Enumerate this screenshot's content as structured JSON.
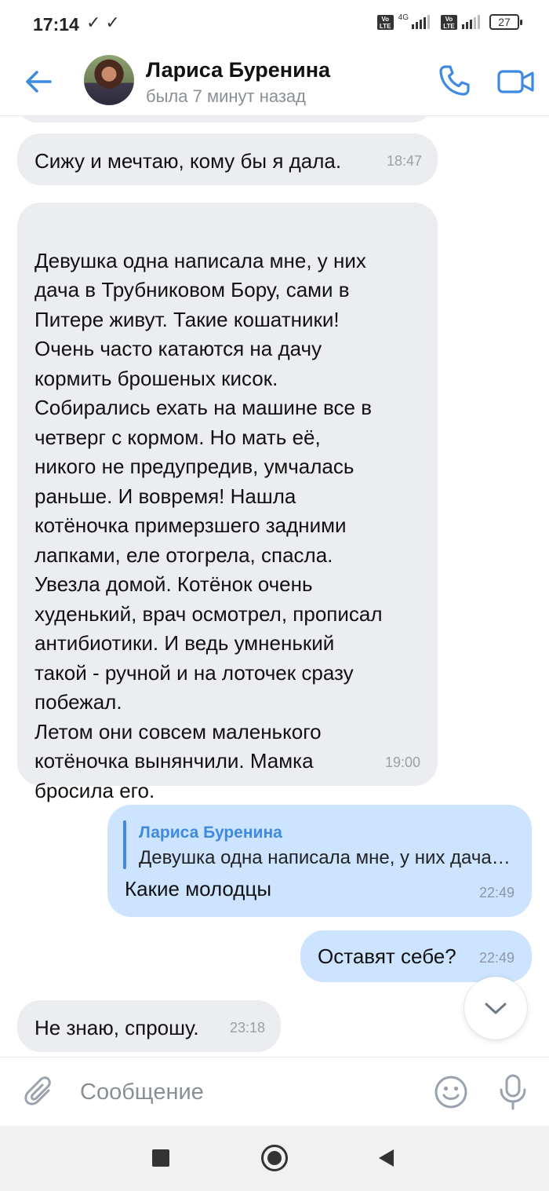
{
  "status_bar": {
    "time": "17:14",
    "checks": "✓✓",
    "volte1": "Vo LTE",
    "network": "4G",
    "volte2": "Vo LTE",
    "battery": "27"
  },
  "header": {
    "contact_name": "Лариса Буренина",
    "contact_status": "была 7 минут назад"
  },
  "messages": [
    {
      "direction": "incoming",
      "text": "Сижу и мечтаю, кому бы я дала.",
      "time": "18:47"
    },
    {
      "direction": "incoming",
      "text": "Девушка одна написала мне, у них\nдача в Трубниковом Бору, сами в\nПитере живут. Такие кошатники!\nОчень часто катаются на дачу\nкормить брошеных кисок.\nСобирались ехать на машине все в\nчетверг с кормом. Но мать её,\nникого не предупредив, умчалась\nраньше. И вовремя! Нашла\nкотёночка примерзшего задними\nлапками, еле отогрела, спасла.\nУвезла домой. Котёнок очень\nхуденький, врач осмотрел, прописал\nантибиотики. И ведь умненький\nтакой - ручной и на лоточек сразу\nпобежал.\nЛетом они  совсем маленького\nкотёночка вынянчили. Мамка\nбросила его.",
      "time": "19:00"
    },
    {
      "direction": "outgoing",
      "reply_author": "Лариса Буренина",
      "reply_text": "Девушка одна написала мне, у них дача в Трубниковом Бору, сами в Питере живут.",
      "text": "Какие молодцы",
      "time": "22:49"
    },
    {
      "direction": "outgoing",
      "text": "Оставят себе?",
      "time": "22:49"
    },
    {
      "direction": "incoming",
      "text": "Не знаю, спрошу.",
      "time": "23:18"
    }
  ],
  "composer": {
    "placeholder": "Сообщение"
  },
  "colors": {
    "accent": "#3f8ae0",
    "incoming_bubble": "#ebedf0",
    "outgoing_bubble": "#cce4ff"
  },
  "icons": {
    "back": "arrow-left-icon",
    "call": "phone-icon",
    "video": "video-camera-icon",
    "scroll": "chevron-down-icon",
    "attach": "paperclip-icon",
    "emoji": "smiley-icon",
    "mic": "microphone-icon"
  }
}
